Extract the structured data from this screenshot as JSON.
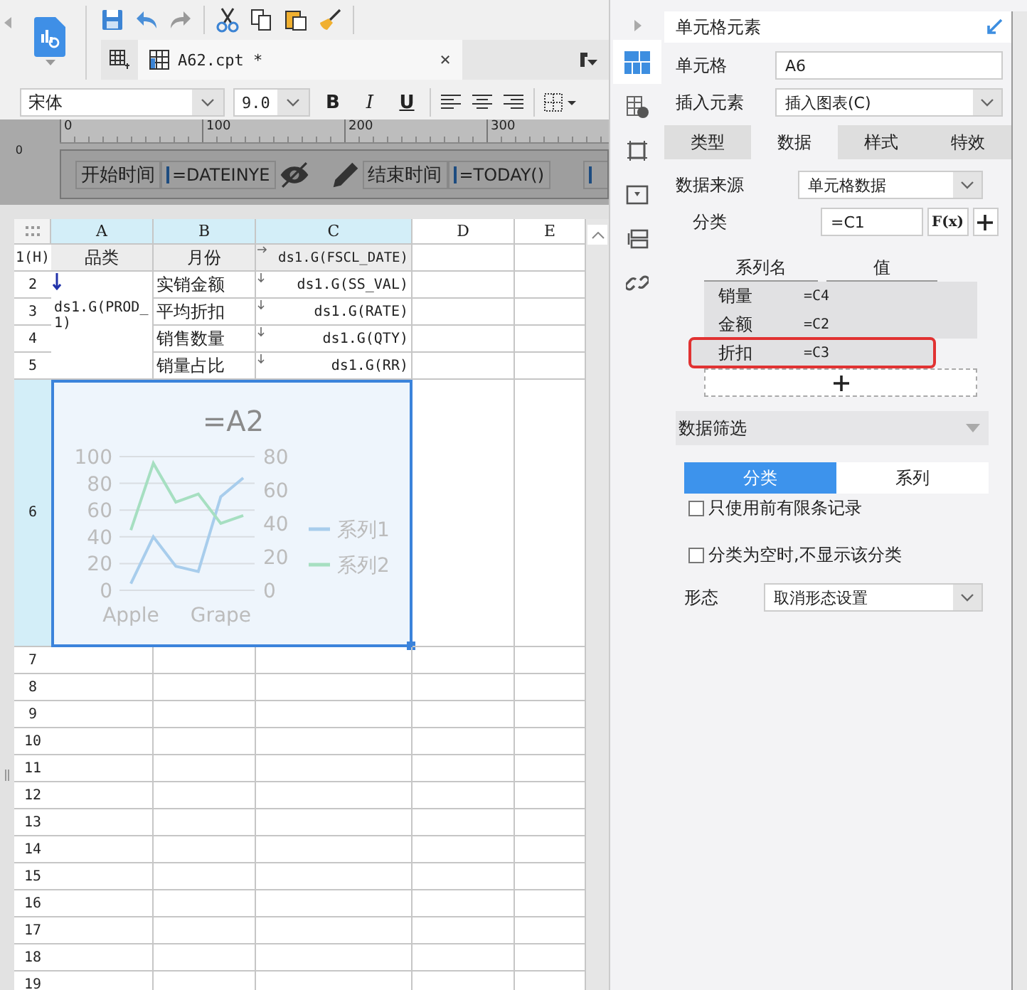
{
  "toolbar": {
    "file_tab": {
      "title": "A62.cpt *",
      "close": "×"
    }
  },
  "format_bar": {
    "font": "宋体",
    "size": "9.0",
    "bold": "B",
    "italic": "I",
    "underline": "U"
  },
  "ruler": {
    "ticks": [
      "0",
      "100",
      "200",
      "300"
    ],
    "vertical": "0"
  },
  "parameters": [
    {
      "kind": "label",
      "text": "开始时间"
    },
    {
      "kind": "field",
      "value": "=DATEINYE"
    },
    {
      "kind": "calendar"
    },
    {
      "kind": "label",
      "text": "结束时间"
    },
    {
      "kind": "field",
      "value": "=TODAY()"
    },
    {
      "kind": "calendar"
    },
    {
      "kind": "field"
    }
  ],
  "sheet": {
    "columns": [
      {
        "label": "A",
        "selected": true
      },
      {
        "label": "B",
        "selected": true
      },
      {
        "label": "C",
        "selected": true
      },
      {
        "label": "D",
        "selected": false
      },
      {
        "label": "E",
        "selected": false
      }
    ],
    "rows": [
      {
        "label": "1(H)",
        "selected": false
      },
      {
        "label": "2",
        "selected": false
      },
      {
        "label": "3",
        "selected": false
      },
      {
        "label": "4",
        "selected": false
      },
      {
        "label": "5",
        "selected": false
      },
      {
        "label": "6",
        "selected": true
      },
      {
        "label": "7",
        "selected": false
      },
      {
        "label": "8",
        "selected": false
      },
      {
        "label": "9",
        "selected": false
      },
      {
        "label": "10",
        "selected": false
      },
      {
        "label": "11",
        "selected": false
      },
      {
        "label": "12",
        "selected": false
      },
      {
        "label": "13",
        "selected": false
      },
      {
        "label": "14",
        "selected": false
      },
      {
        "label": "15",
        "selected": false
      },
      {
        "label": "16",
        "selected": false
      },
      {
        "label": "17",
        "selected": false
      },
      {
        "label": "18",
        "selected": false
      },
      {
        "label": "19",
        "selected": false
      }
    ],
    "cells": [
      [
        {
          "text": "品类",
          "kind": "header"
        },
        {
          "text": "月份",
          "kind": "header"
        },
        {
          "text": "ds1.G(FSCL_DATE)",
          "kind": "header",
          "expand_right": true
        }
      ],
      [
        {
          "text": "ds1.G(PROD_1)",
          "kind": "formula",
          "expand_down": true
        },
        {
          "text": "实销金额",
          "kind": "text"
        },
        {
          "text": "ds1.G(SS_VAL)",
          "kind": "formula",
          "expand_down": true
        }
      ],
      [
        {
          "text": "平均折扣",
          "kind": "text"
        },
        {
          "text": "ds1.G(RATE)",
          "kind": "formula",
          "expand_down": true
        }
      ],
      [
        {
          "text": "销售数量",
          "kind": "text"
        },
        {
          "text": "ds1.G(QTY)",
          "kind": "formula",
          "expand_down": true
        }
      ],
      [
        {
          "text": "销量占比",
          "kind": "text"
        },
        {
          "text": "ds1.G(RR)",
          "kind": "formula",
          "expand_down": true
        }
      ]
    ],
    "chart_cell": {
      "selected": true,
      "chart_data": {
        "type": "line",
        "title": "=A2",
        "categories": [
          "Apple",
          null,
          null,
          null,
          "Grape",
          null
        ],
        "ylim": [
          0,
          100
        ],
        "yticks": [
          0,
          20,
          40,
          60,
          80,
          100
        ],
        "y2lim": [
          0,
          80
        ],
        "grid": true,
        "legend": "right",
        "y2ticks": [
          0,
          20,
          40,
          60,
          80
        ],
        "series": [
          {
            "name": "系列1",
            "color": "#a8cdec",
            "values": [
              5,
              40,
              18,
              14,
              70,
              84
            ]
          },
          {
            "name": "系列2",
            "color": "#a6dfc1",
            "values": [
              45,
              95,
              66,
              72,
              50,
              56
            ]
          }
        ]
      }
    }
  },
  "side_panel": {
    "title": "单元格元素",
    "icons": [
      {
        "kind": "cell-element",
        "selected": true
      },
      {
        "kind": "cell-attribute",
        "selected": false
      },
      {
        "kind": "border",
        "selected": false
      },
      {
        "kind": "widget",
        "selected": false
      },
      {
        "kind": "condition",
        "selected": false
      },
      {
        "kind": "link",
        "selected": false
      }
    ],
    "cell_field": {
      "label": "单元格",
      "value": "A6"
    },
    "insert_field": {
      "label": "插入元素",
      "value": "插入图表(C)"
    },
    "tabs": [
      {
        "label": "类型",
        "selected": false
      },
      {
        "label": "数据",
        "selected": true
      },
      {
        "label": "样式",
        "selected": false
      },
      {
        "label": "特效",
        "selected": false
      }
    ],
    "data_source": {
      "label": "数据来源",
      "value": "单元格数据"
    },
    "category": {
      "label": "分类",
      "value": "=C1",
      "formula_button": "F(x)"
    },
    "series_table": {
      "columns": [
        "系列名",
        "值"
      ],
      "rows": [
        {
          "name": "销量",
          "value": "=C4",
          "highlighted": false
        },
        {
          "name": "金额",
          "value": "=C2",
          "highlighted": false
        },
        {
          "name": "折扣",
          "value": "=C3",
          "highlighted": true
        }
      ]
    },
    "filter": {
      "title": "数据筛选",
      "tabs": [
        {
          "label": "分类",
          "selected": true
        },
        {
          "label": "系列",
          "selected": false
        }
      ],
      "options": [
        {
          "label": "只使用前有限条记录",
          "checked": false
        },
        {
          "label": "分类为空时,不显示该分类",
          "checked": false
        }
      ],
      "form": {
        "label": "形态",
        "value": "取消形态设置"
      }
    }
  }
}
